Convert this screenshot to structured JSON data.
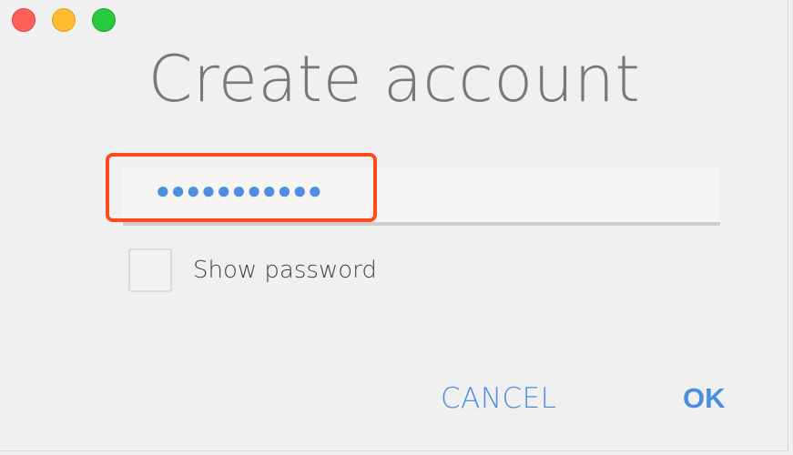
{
  "window": {
    "title": "Create account",
    "controls": {
      "close_color": "#fe5f57",
      "minimize_color": "#febc2e",
      "maximize_color": "#28c840"
    }
  },
  "form": {
    "password": {
      "masked_value": "●●●●●●●●●●●"
    },
    "show_password": {
      "label": "Show password",
      "checked": false
    }
  },
  "actions": {
    "cancel_label": "CANCEL",
    "ok_label": "OK"
  },
  "colors": {
    "accent": "#4a8ee0",
    "highlight": "#ff4a1c"
  }
}
